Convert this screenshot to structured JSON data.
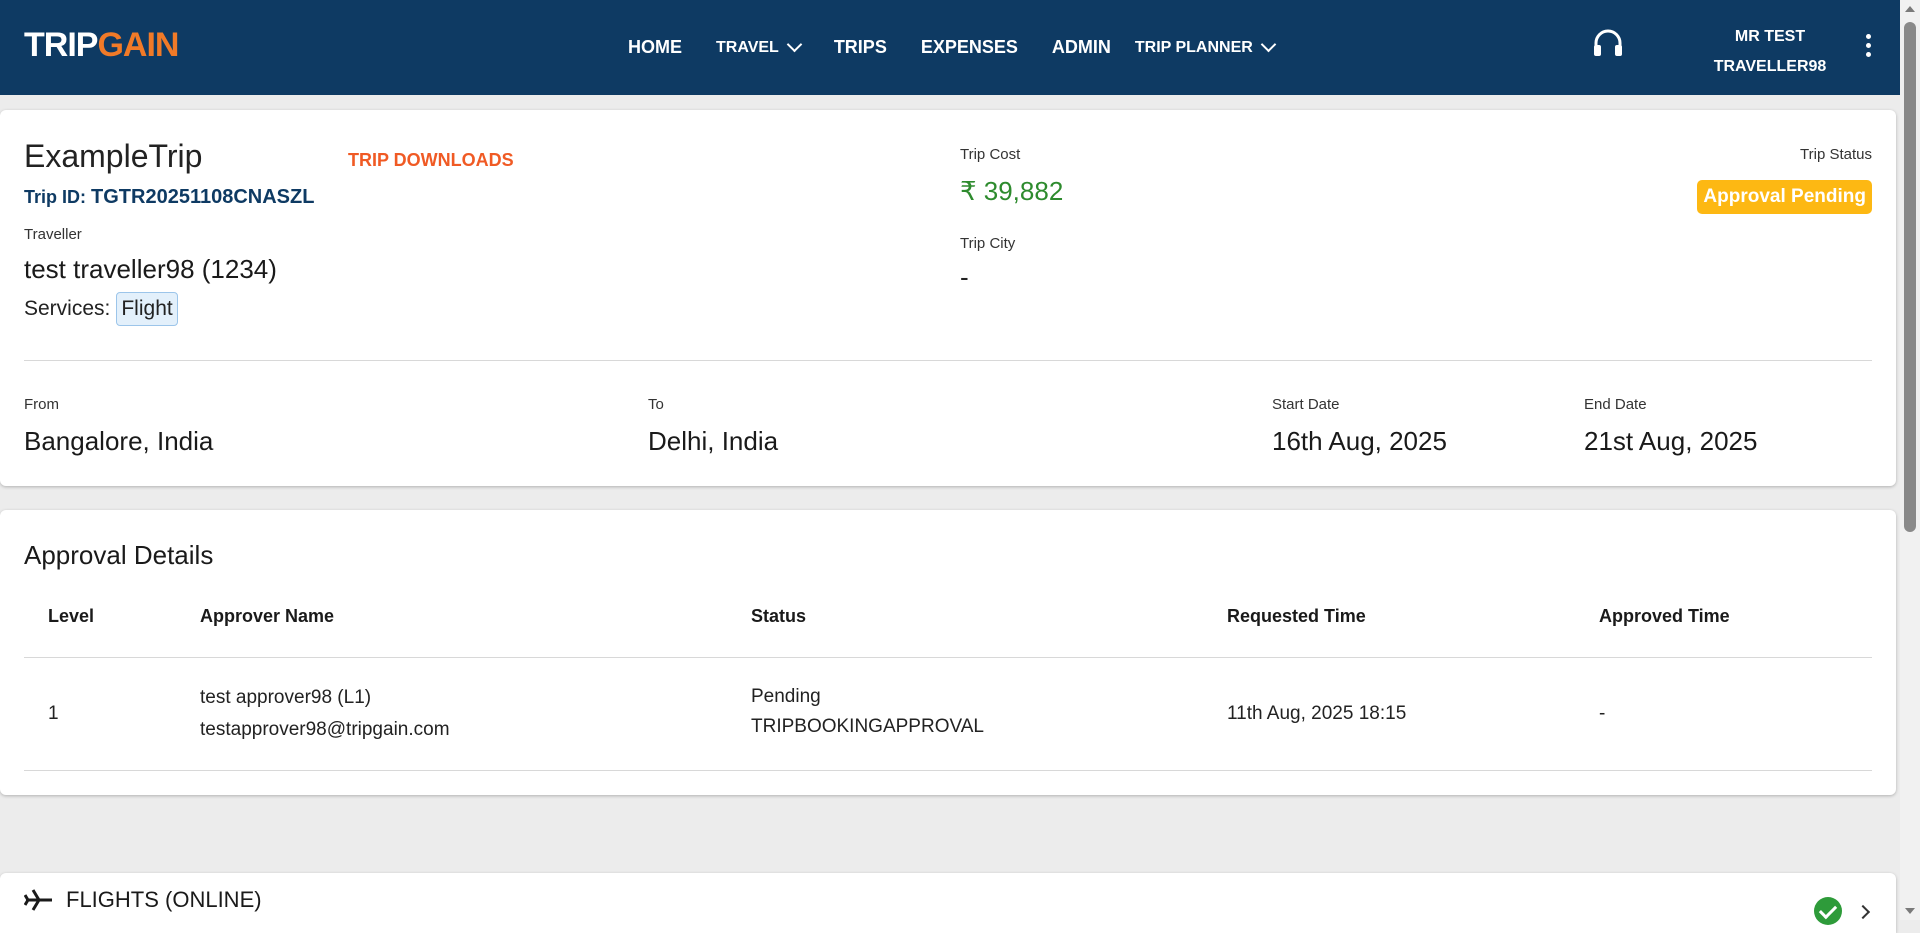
{
  "header": {
    "logo_trip": "TRIP",
    "logo_gain": "GAIN",
    "nav": {
      "home": "HOME",
      "travel": "TRAVEL",
      "trips": "TRIPS",
      "expenses": "EXPENSES",
      "admin": "ADMIN",
      "trip_planner": "TRIP PLANNER"
    },
    "user_line1": "MR TEST",
    "user_line2": "TRAVELLER98",
    "colors": {
      "bar": "#0e3a63",
      "logo_accent": "#f07a28"
    }
  },
  "trip": {
    "name": "ExampleTrip",
    "downloads_label": "TRIP DOWNLOADS",
    "id_label": "Trip ID:",
    "id_value": "TGTR20251108CNASZL",
    "traveller_label": "Traveller",
    "traveller_value": "test traveller98 (1234)",
    "services_label": "Services:",
    "service_chip": "Flight",
    "cost_label": "Trip Cost",
    "cost_value": "₹ 39,882",
    "city_label": "Trip City",
    "city_value": "-",
    "status_label": "Trip Status",
    "status_value": "Approval Pending",
    "status_color": "#fdb813",
    "from_label": "From",
    "from_value": "Bangalore, India",
    "to_label": "To",
    "to_value": "Delhi, India",
    "start_label": "Start Date",
    "start_value": "16th Aug, 2025",
    "end_label": "End Date",
    "end_value": "21st Aug, 2025"
  },
  "approval": {
    "title": "Approval Details",
    "columns": [
      "Level",
      "Approver Name",
      "Status",
      "Requested Time",
      "Approved Time"
    ],
    "rows": [
      {
        "level": "1",
        "approver_name": "test approver98 (L1)",
        "approver_email": "testapprover98@tripgain.com",
        "status": "Pending",
        "status_type": "TRIPBOOKINGAPPROVAL",
        "requested_time": "11th Aug, 2025 18:15",
        "approved_time": "-"
      }
    ]
  },
  "flights_section": {
    "label": "FLIGHTS (ONLINE)",
    "status_icon": "check-circle-icon"
  }
}
